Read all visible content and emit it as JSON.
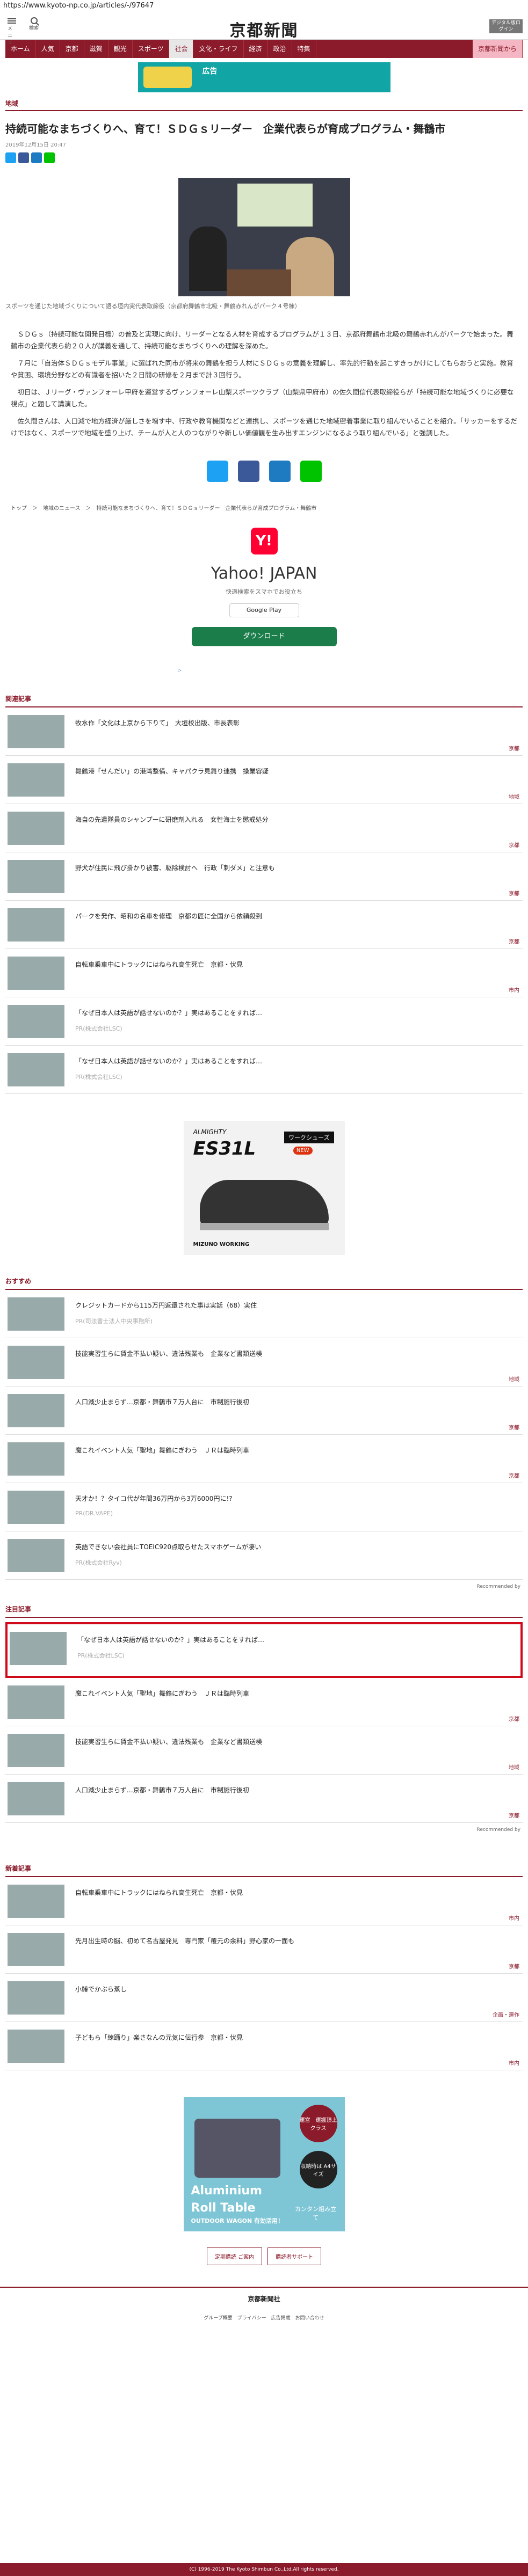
{
  "url": "https://www.kyoto-np.co.jp/articles/-/97647",
  "header": {
    "menu_label": "メニュー",
    "search_label": "検索",
    "logo": "京都新聞",
    "digital": "デジタル版ログイン"
  },
  "nav": [
    "ホーム",
    "人気",
    "京都",
    "滋賀",
    "観光",
    "スポーツ",
    "社会",
    "文化・ライフ",
    "経済",
    "政治",
    "特集",
    "京都新聞から"
  ],
  "banner": {
    "t1": "広告",
    "t2": ""
  },
  "article": {
    "section": "地域",
    "title": "持続可能なまちづくりへ、育て！ＳＤＧｓリーダー　企業代表らが育成プログラム・舞鶴市",
    "date": "2019年12月15日 20:47",
    "caption": "スポーツを通じた地域づくりについて語る垣内実代表取締役（京都府舞鶴市北吸・舞鶴赤れんがパーク４号棟）",
    "paragraphs": [
      "ＳＤＧｓ（持続可能な開発目標）の普及と実現に向け、リーダーとなる人材を育成するプログラムが１３日、京都府舞鶴市北吸の舞鶴赤れんがパークで始まった。舞鶴市の企業代表ら約２０人が講義を通して、持続可能なまちづくりへの理解を深めた。",
      "７月に「自治体ＳＤＧｓモデル事業」に選ばれた同市が将来の舞鶴を担う人材にＳＤＧｓの意義を理解し、率先的行動を起こすきっかけにしてもらおうと実施。教育や貧困、環境分野などの有識者を招いた２日間の研修を２月まで計３回行う。",
      "初日は、Ｊリーグ・ヴァンフォーレ甲府を運営するヴァンフォーレ山梨スポーツクラブ（山梨県甲府市）の佐久間信代表取締役らが「持続可能な地域づくりに必要な視点」と題して講演した。",
      "佐久間さんは、人口減で地方経済が厳しさを増す中、行政や教育機関などと連携し、スポーツを通じた地域密着事業に取り組んでいることを紹介。「サッカーをするだけではなく、スポーツで地域を盛り上げ、チームが人と人のつながりや新しい価値観を生み出すエンジンになるよう取り組んでいる」と強調した。"
    ],
    "breadcrumb": "トップ　＞　地域のニュース　＞　持続可能なまちづくりへ、育て！ＳＤＧｓリーダー　企業代表らが育成プログラム・舞鶴市"
  },
  "yahoo_ad": {
    "logo": "Y!",
    "title": "Yahoo! JAPAN",
    "sub": "快適検索をスマホでお役立ち",
    "gplay": "Google Play",
    "dl": "ダウンロード"
  },
  "related": {
    "head": "関連記事",
    "items": [
      {
        "t": "牧水作「文化は上京から下りて」　大垣校出版、市長表彰",
        "sub": "",
        "tag": "京都"
      },
      {
        "t": "舞鶴港「せんだい」の港湾整備、キャパクラ見舞り連携　操業容疑",
        "sub": "",
        "tag": "地域"
      },
      {
        "t": "海自の先遣隊員のシャンプーに研磨剤入れる　女性海士を懲戒処分",
        "sub": "",
        "tag": "京都"
      },
      {
        "t": "野犬が住民に飛び掛かり被害、駆除検討へ　行政「刺ダメ」と注意も",
        "sub": "",
        "tag": "京都"
      },
      {
        "t": "パークを発作、昭和の名車を修理　京都の匠に全国から依頼殺到",
        "sub": "",
        "tag": "京都"
      },
      {
        "t": "自転車乗車中にトラックにはねられ高生死亡　京都・伏見",
        "sub": "",
        "tag": "市内"
      },
      {
        "t": "「なぜ日本人は英語が話せないのか？」実はあることをすれば…",
        "sub": "PR(株式会社LSC)",
        "tag": ""
      },
      {
        "t": "「なぜ日本人は英語が話せないのか？」実はあることをすれば…",
        "sub": "PR(株式会社LSC)",
        "tag": ""
      }
    ]
  },
  "shoe_ad": {
    "brand": "ALMIGHTY",
    "model": "ES31L",
    "pill": "ワークシューズ",
    "new": "NEW",
    "foot": "MIZUNO WORKING"
  },
  "recommend": {
    "head": "おすすめ",
    "items": [
      {
        "t": "クレジットカードから115万円返還された事は実話（68）実住",
        "sub": "PR(司法書士法人中央事務所)",
        "tag": ""
      },
      {
        "t": "技能実習生らに賃金不払い疑い、違法残業も　企業など書類送検",
        "sub": "",
        "tag": "地域"
      },
      {
        "t": "人口減少止まらず…京都・舞鶴市７万人台に　市制施行後初",
        "sub": "",
        "tag": "京都"
      },
      {
        "t": "魔これイベント人気「聖地」舞鶴にぎわう　ＪＲは臨時列車",
        "sub": "",
        "tag": "京都"
      },
      {
        "t": "天才か！？タイコ代が年間36万円から3万6000円に!?",
        "sub": "PR(DR.VAPE)",
        "tag": ""
      },
      {
        "t": "英語できない会社員にTOEIC920点取らせたスマホゲームが凄い",
        "sub": "PR(株式会社Ryv)",
        "tag": ""
      }
    ],
    "note": "Recommended by"
  },
  "notable": {
    "head": "注目記事",
    "items": [
      {
        "t": "「なぜ日本人は英語が話せないのか？」実はあることをすれば…",
        "sub": "PR(株式会社LSC)",
        "tag": ""
      },
      {
        "t": "魔これイベント人気「聖地」舞鶴にぎわう　ＪＲは臨時列車",
        "sub": "",
        "tag": "京都"
      },
      {
        "t": "技能実習生らに賃金不払い疑い、違法残業も　企業など書類送検",
        "sub": "",
        "tag": "地域"
      },
      {
        "t": "人口減少止まらず…京都・舞鶴市７万人台に　市制施行後初",
        "sub": "",
        "tag": "京都"
      }
    ],
    "note": "Recommended by"
  },
  "latest": {
    "head": "新着記事",
    "items": [
      {
        "t": "自転車乗車中にトラックにはねられ高生死亡　京都・伏見",
        "sub": "",
        "tag": "市内"
      },
      {
        "t": "先月出生時の脳、初めて名古屋発見　専門家「覆元の余料」野心家の一面も",
        "sub": "",
        "tag": "京都"
      },
      {
        "t": "小鰆でかぶら蒸し",
        "sub": "",
        "tag": "企画・連作"
      },
      {
        "t": "子どもら「練踊り」楽さなんの元気に伝行参　京都・伏見",
        "sub": "",
        "tag": "市内"
      }
    ]
  },
  "alum_ad": {
    "t1": "Aluminium",
    "t2": "Roll Table",
    "t3": "OUTDOOR WAGON 有効活用！",
    "tr": "運営　運搬頂上クラス",
    "tr2": "収納時は A4サイズ",
    "t4": "カンタン組み立て"
  },
  "footer": {
    "btn1": "定期購読 ご案内",
    "btn2": "購読者サポート",
    "logo": "京都新聞社",
    "links": "グループ概要　プライバシー　広告掲載　お問い合わせ",
    "copy": "(C) 1996-2019 The Kyoto Shimbun Co.,Ltd.All rights reserved."
  }
}
